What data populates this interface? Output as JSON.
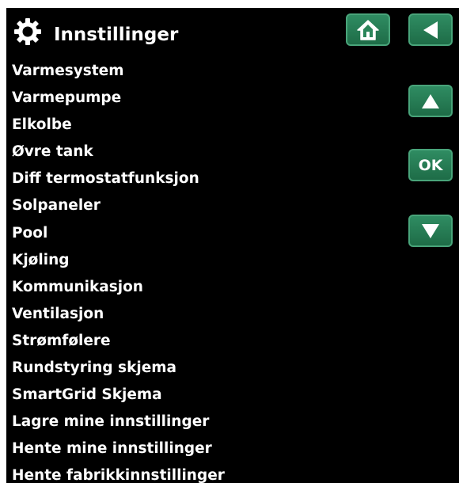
{
  "header": {
    "title": "Innstillinger",
    "title_icon": "gear-icon",
    "home_icon": "home-icon",
    "back_icon": "back-arrow-icon"
  },
  "side_controls": {
    "up_icon": "up-arrow-icon",
    "ok_label": "OK",
    "down_icon": "down-arrow-icon"
  },
  "menu": {
    "items": [
      "Varmesystem",
      "Varmepumpe",
      "Elkolbe",
      "Øvre tank",
      "Diff termostatfunksjon",
      "Solpaneler",
      "Pool",
      "Kjøling",
      "Kommunikasjon",
      "Ventilasjon",
      "Strømfølere",
      "Rundstyring skjema",
      "SmartGrid Skjema",
      "Lagre mine innstillinger",
      "Hente mine innstillinger",
      "Hente fabrikkinnstillinger"
    ]
  },
  "colors": {
    "background": "#000000",
    "text": "#ffffff",
    "button_fill": "#2a8559",
    "button_border": "#49a47a"
  }
}
